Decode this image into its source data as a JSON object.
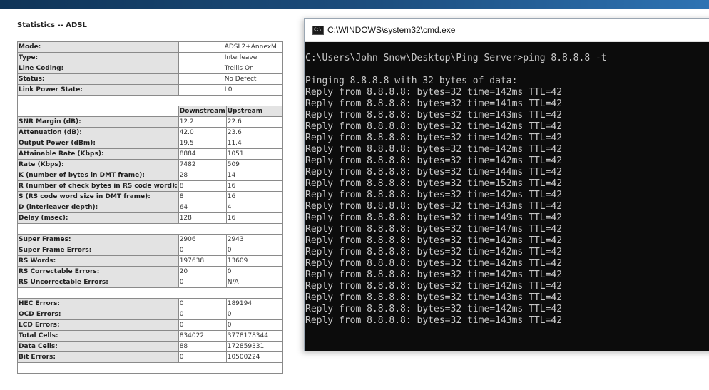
{
  "router": {
    "title": "Statistics -- ADSL",
    "info_rows": [
      {
        "label": "Mode:",
        "value": "ADSL2+AnnexM"
      },
      {
        "label": "Type:",
        "value": "Interleave"
      },
      {
        "label": "Line Coding:",
        "value": "Trellis On"
      },
      {
        "label": "Status:",
        "value": "No Defect"
      },
      {
        "label": "Link Power State:",
        "value": "L0"
      }
    ],
    "headers": {
      "downstream": "Downstream",
      "upstream": "Upstream"
    },
    "line_rows": [
      {
        "label": "SNR Margin (dB):",
        "down": "12.2",
        "up": "22.6"
      },
      {
        "label": "Attenuation (dB):",
        "down": "42.0",
        "up": "23.6"
      },
      {
        "label": "Output Power (dBm):",
        "down": "19.5",
        "up": "11.4"
      },
      {
        "label": "Attainable Rate (Kbps):",
        "down": "8884",
        "up": "1051"
      },
      {
        "label": "Rate (Kbps):",
        "down": "7482",
        "up": "509"
      },
      {
        "label": "K (number of bytes in DMT frame):",
        "down": "28",
        "up": "14"
      },
      {
        "label": "R (number of check bytes in RS code word):",
        "down": "8",
        "up": "16"
      },
      {
        "label": "S (RS code word size in DMT frame):",
        "down": "8",
        "up": "16"
      },
      {
        "label": "D (interleaver depth):",
        "down": "64",
        "up": "4"
      },
      {
        "label": "Delay (msec):",
        "down": "128",
        "up": "16"
      }
    ],
    "frame_rows": [
      {
        "label": "Super Frames:",
        "down": "2906",
        "up": "2943"
      },
      {
        "label": "Super Frame Errors:",
        "down": "0",
        "up": "0"
      },
      {
        "label": "RS Words:",
        "down": "197638",
        "up": "13609"
      },
      {
        "label": "RS Correctable Errors:",
        "down": "20",
        "up": "0"
      },
      {
        "label": "RS Uncorrectable Errors:",
        "down": "0",
        "up": "N/A"
      }
    ],
    "error_rows": [
      {
        "label": "HEC Errors:",
        "down": "0",
        "up": "189194"
      },
      {
        "label": "OCD Errors:",
        "down": "0",
        "up": "0"
      },
      {
        "label": "LCD Errors:",
        "down": "0",
        "up": "0"
      },
      {
        "label": "Total Cells:",
        "down": "834022",
        "up": "3778178344"
      },
      {
        "label": "Data Cells:",
        "down": "88",
        "up": "172859331"
      },
      {
        "label": "Bit Errors:",
        "down": "0",
        "up": "10500224"
      }
    ]
  },
  "cmd": {
    "title": "C:\\WINDOWS\\system32\\cmd.exe",
    "icon_text": "C:\\",
    "prompt": "C:\\Users\\John Snow\\Desktop\\Ping Server>ping 8.8.8.8 -t",
    "pinging": "Pinging 8.8.8.8 with 32 bytes of data:",
    "replies": [
      "Reply from 8.8.8.8: bytes=32 time=142ms TTL=42",
      "Reply from 8.8.8.8: bytes=32 time=141ms TTL=42",
      "Reply from 8.8.8.8: bytes=32 time=143ms TTL=42",
      "Reply from 8.8.8.8: bytes=32 time=142ms TTL=42",
      "Reply from 8.8.8.8: bytes=32 time=142ms TTL=42",
      "Reply from 8.8.8.8: bytes=32 time=142ms TTL=42",
      "Reply from 8.8.8.8: bytes=32 time=142ms TTL=42",
      "Reply from 8.8.8.8: bytes=32 time=144ms TTL=42",
      "Reply from 8.8.8.8: bytes=32 time=152ms TTL=42",
      "Reply from 8.8.8.8: bytes=32 time=142ms TTL=42",
      "Reply from 8.8.8.8: bytes=32 time=143ms TTL=42",
      "Reply from 8.8.8.8: bytes=32 time=149ms TTL=42",
      "Reply from 8.8.8.8: bytes=32 time=147ms TTL=42",
      "Reply from 8.8.8.8: bytes=32 time=142ms TTL=42",
      "Reply from 8.8.8.8: bytes=32 time=142ms TTL=42",
      "Reply from 8.8.8.8: bytes=32 time=142ms TTL=42",
      "Reply from 8.8.8.8: bytes=32 time=142ms TTL=42",
      "Reply from 8.8.8.8: bytes=32 time=142ms TTL=42",
      "Reply from 8.8.8.8: bytes=32 time=143ms TTL=42",
      "Reply from 8.8.8.8: bytes=32 time=142ms TTL=42",
      "Reply from 8.8.8.8: bytes=32 time=143ms TTL=42"
    ]
  }
}
